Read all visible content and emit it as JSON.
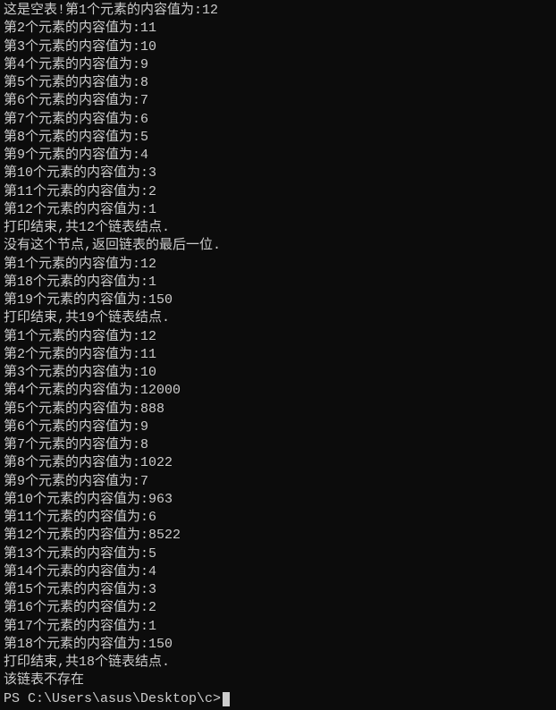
{
  "terminal": {
    "lines": [
      "这是空表!第1个元素的内容值为:12",
      "第2个元素的内容值为:11",
      "第3个元素的内容值为:10",
      "第4个元素的内容值为:9",
      "第5个元素的内容值为:8",
      "第6个元素的内容值为:7",
      "第7个元素的内容值为:6",
      "第8个元素的内容值为:5",
      "第9个元素的内容值为:4",
      "第10个元素的内容值为:3",
      "第11个元素的内容值为:2",
      "第12个元素的内容值为:1",
      "打印结束,共12个链表结点.",
      "没有这个节点,返回链表的最后一位.",
      "第1个元素的内容值为:12",
      "第18个元素的内容值为:1",
      "第19个元素的内容值为:150",
      "打印结束,共19个链表结点.",
      "第1个元素的内容值为:12",
      "第2个元素的内容值为:11",
      "第3个元素的内容值为:10",
      "第4个元素的内容值为:12000",
      "第5个元素的内容值为:888",
      "第6个元素的内容值为:9",
      "第7个元素的内容值为:8",
      "第8个元素的内容值为:1022",
      "第9个元素的内容值为:7",
      "第10个元素的内容值为:963",
      "第11个元素的内容值为:6",
      "第12个元素的内容值为:8522",
      "第13个元素的内容值为:5",
      "第14个元素的内容值为:4",
      "第15个元素的内容值为:3",
      "第16个元素的内容值为:2",
      "第17个元素的内容值为:1",
      "第18个元素的内容值为:150",
      "打印结束,共18个链表结点.",
      "该链表不存在"
    ],
    "prompt": "PS C:\\Users\\asus\\Desktop\\c>"
  }
}
